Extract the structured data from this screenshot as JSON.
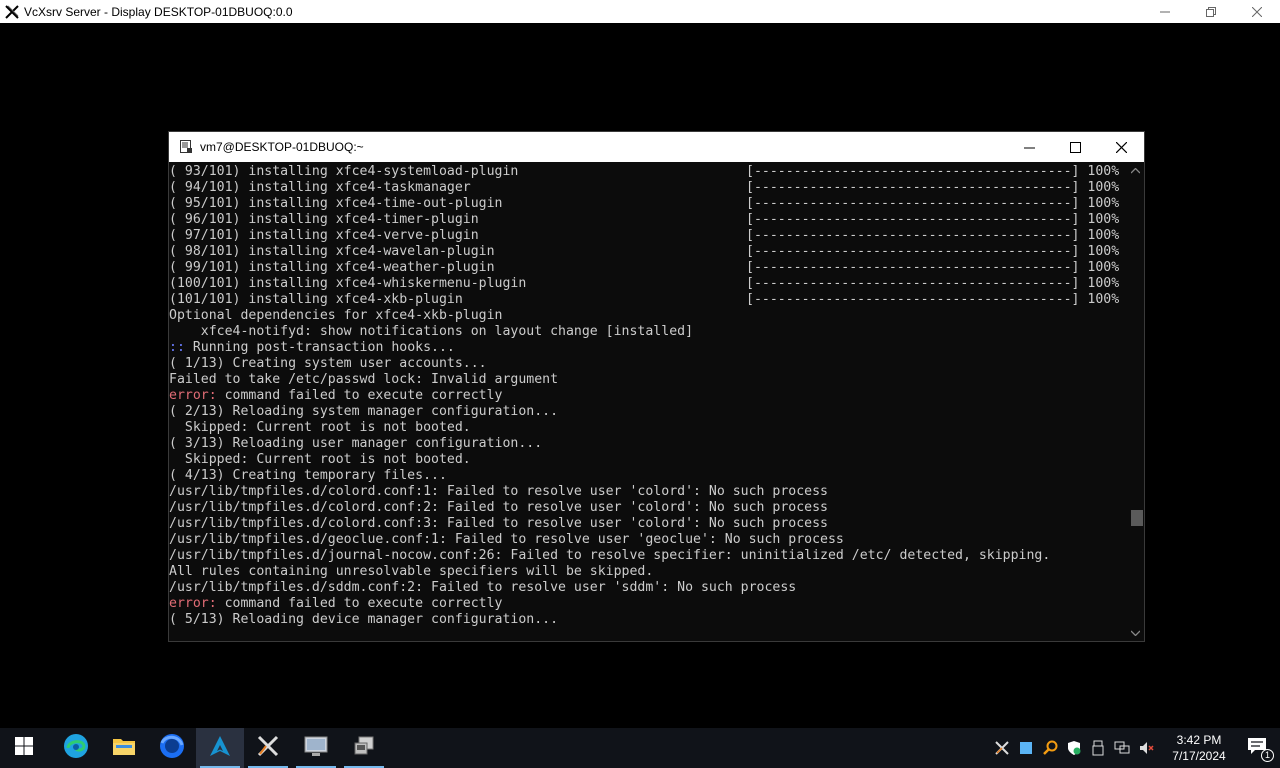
{
  "outer_window": {
    "title": "VcXsrv Server - Display DESKTOP-01DBUOQ:0.0"
  },
  "terminal": {
    "title": "vm7@DESKTOP-01DBUOQ:~",
    "lines": [
      {
        "text": "( 93/101) installing xfce4-systemload-plugin",
        "progress": "[----------------------------------------] 100%"
      },
      {
        "text": "( 94/101) installing xfce4-taskmanager",
        "progress": "[----------------------------------------] 100%"
      },
      {
        "text": "( 95/101) installing xfce4-time-out-plugin",
        "progress": "[----------------------------------------] 100%"
      },
      {
        "text": "( 96/101) installing xfce4-timer-plugin",
        "progress": "[----------------------------------------] 100%"
      },
      {
        "text": "( 97/101) installing xfce4-verve-plugin",
        "progress": "[----------------------------------------] 100%"
      },
      {
        "text": "( 98/101) installing xfce4-wavelan-plugin",
        "progress": "[----------------------------------------] 100%"
      },
      {
        "text": "( 99/101) installing xfce4-weather-plugin",
        "progress": "[----------------------------------------] 100%"
      },
      {
        "text": "(100/101) installing xfce4-whiskermenu-plugin",
        "progress": "[----------------------------------------] 100%"
      },
      {
        "text": "(101/101) installing xfce4-xkb-plugin",
        "progress": "[----------------------------------------] 100%"
      },
      {
        "text": "Optional dependencies for xfce4-xkb-plugin"
      },
      {
        "text": "    xfce4-notifyd: show notifications on layout change [installed]"
      },
      {
        "prefix": "::",
        "prefix_style": "cyan",
        "text": " Running post-transaction hooks..."
      },
      {
        "text": "( 1/13) Creating system user accounts..."
      },
      {
        "text": "Failed to take /etc/passwd lock: Invalid argument"
      },
      {
        "prefix": "error:",
        "prefix_style": "err",
        "text": " command failed to execute correctly"
      },
      {
        "text": "( 2/13) Reloading system manager configuration..."
      },
      {
        "text": "  Skipped: Current root is not booted."
      },
      {
        "text": "( 3/13) Reloading user manager configuration..."
      },
      {
        "text": "  Skipped: Current root is not booted."
      },
      {
        "text": "( 4/13) Creating temporary files..."
      },
      {
        "text": "/usr/lib/tmpfiles.d/colord.conf:1: Failed to resolve user 'colord': No such process"
      },
      {
        "text": "/usr/lib/tmpfiles.d/colord.conf:2: Failed to resolve user 'colord': No such process"
      },
      {
        "text": "/usr/lib/tmpfiles.d/colord.conf:3: Failed to resolve user 'colord': No such process"
      },
      {
        "text": "/usr/lib/tmpfiles.d/geoclue.conf:1: Failed to resolve user 'geoclue': No such process"
      },
      {
        "text": "/usr/lib/tmpfiles.d/journal-nocow.conf:26: Failed to resolve specifier: uninitialized /etc/ detected, skipping."
      },
      {
        "text": "All rules containing unresolvable specifiers will be skipped."
      },
      {
        "text": "/usr/lib/tmpfiles.d/sddm.conf:2: Failed to resolve user 'sddm': No such process"
      },
      {
        "prefix": "error:",
        "prefix_style": "err",
        "text": " command failed to execute correctly"
      },
      {
        "text": "( 5/13) Reloading device manager configuration..."
      }
    ]
  },
  "taskbar": {
    "items": [
      {
        "name": "start-button",
        "icon": "windows-logo-icon"
      },
      {
        "name": "taskbar-edge",
        "icon": "edge-icon"
      },
      {
        "name": "taskbar-file-explorer",
        "icon": "folder-icon"
      },
      {
        "name": "taskbar-firefox",
        "icon": "firefox-icon"
      },
      {
        "name": "taskbar-arch",
        "icon": "arch-icon",
        "state": "active"
      },
      {
        "name": "taskbar-xlaunch",
        "icon": "xlaunch-icon",
        "state": "running"
      },
      {
        "name": "taskbar-vcxsrv",
        "icon": "vcxsrv-icon",
        "state": "running"
      },
      {
        "name": "taskbar-app",
        "icon": "app-icon",
        "state": "running"
      }
    ],
    "clock": {
      "time": "3:42 PM",
      "date": "7/17/2024"
    },
    "notification_count": "1"
  }
}
